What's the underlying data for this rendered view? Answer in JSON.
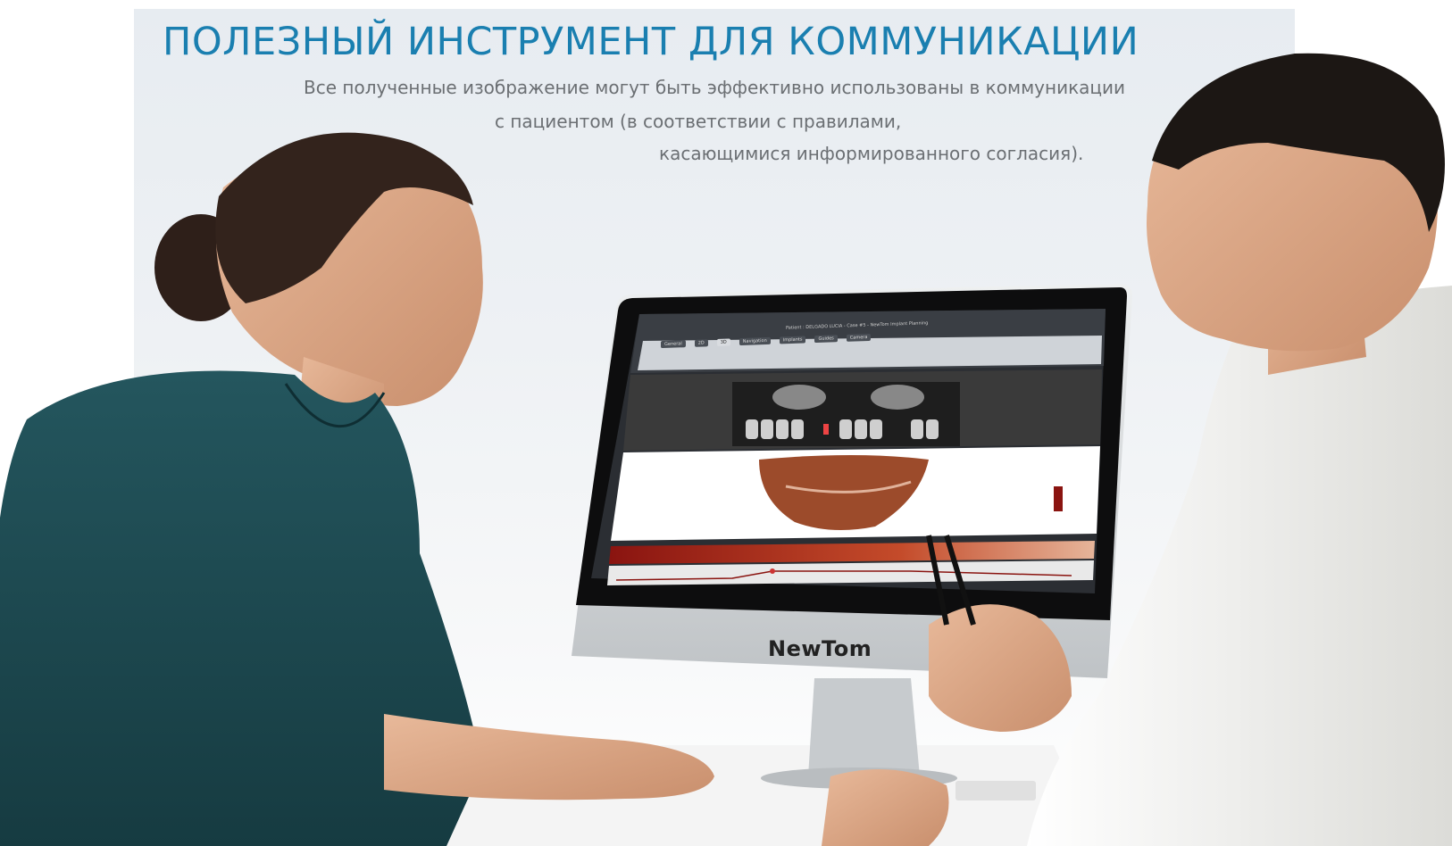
{
  "headline": "ПОЛЕЗНЫЙ ИНСТРУМЕНТ ДЛЯ КОММУНИКАЦИИ",
  "subtext": {
    "line1": "Все полученные изображение могут быть эффективно использованы в коммуникации",
    "line2": "с пациентом (в соответствии с правилами,",
    "line3": "касающимися информированного согласия)."
  },
  "monitor": {
    "brand": "NewTom",
    "window_title": "Patient : DELGADO LUCIA - Case #5 - NewTom Implant Planning",
    "tabs": [
      "General",
      "2D",
      "3D",
      "Navigation",
      "Implants",
      "Guides",
      "Camera"
    ],
    "active_tab": "3D"
  },
  "colors": {
    "headline": "#1a7fb0",
    "subtext": "#6b6f73",
    "shirt": "#1f4e55",
    "coat": "#f2f2f0"
  }
}
